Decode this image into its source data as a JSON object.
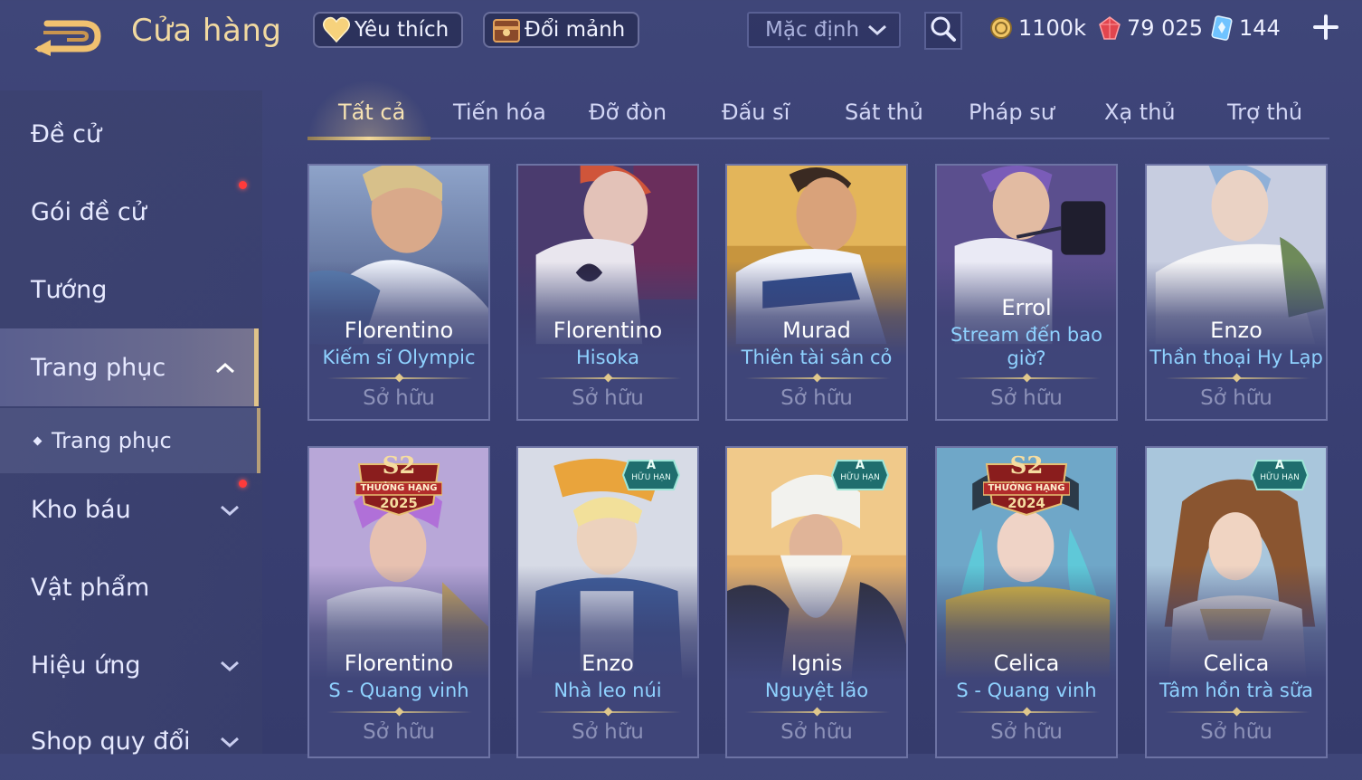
{
  "header": {
    "title": "Cửa hàng",
    "favorites_label": "Yêu thích",
    "exchange_label": "Đổi mảnh",
    "sort_label": "Mặc định",
    "currencies": [
      {
        "name": "gold",
        "value": "1100k"
      },
      {
        "name": "vouchers",
        "value": "79 025"
      },
      {
        "name": "diamonds",
        "value": "144"
      }
    ]
  },
  "sidebar": {
    "items": [
      {
        "label": "Đề cử"
      },
      {
        "label": "Gói đề cử"
      },
      {
        "label": "Tướng"
      },
      {
        "label": "Trang phục"
      },
      {
        "label": "Kho báu"
      },
      {
        "label": "Vật phẩm"
      },
      {
        "label": "Hiệu ứng"
      },
      {
        "label": "Shop quy đổi"
      }
    ],
    "sub_item": "Trang phục"
  },
  "tabs": [
    "Tất cả",
    "Tiến hóa",
    "Đỡ đòn",
    "Đấu sĩ",
    "Sát thủ",
    "Pháp sư",
    "Xạ thủ",
    "Trợ thủ"
  ],
  "cards": [
    {
      "hero": "Florentino",
      "skin": "Kiếm sĩ Olympic",
      "status": "Sở hữu"
    },
    {
      "hero": "Florentino",
      "skin": "Hisoka",
      "status": "Sở hữu"
    },
    {
      "hero": "Murad",
      "skin": "Thiên tài sân cỏ",
      "status": "Sở hữu"
    },
    {
      "hero": "Errol",
      "skin": "Stream đến bao giờ?",
      "status": "Sở hữu"
    },
    {
      "hero": "Enzo",
      "skin": "Thần thoại Hy Lạp",
      "status": "Sở hữu"
    },
    {
      "hero": "Florentino",
      "skin": "S - Quang vinh",
      "status": "Sở hữu",
      "badge": {
        "season": "S2",
        "line1": "THƯỞNG HẠNG",
        "year": "2025"
      }
    },
    {
      "hero": "Enzo",
      "skin": "Nhà leo núi",
      "status": "Sở hữu",
      "badge": {
        "tier": "A",
        "line1": "HỮU HẠN"
      }
    },
    {
      "hero": "Ignis",
      "skin": "Nguyệt lão",
      "status": "Sở hữu",
      "badge": {
        "tier": "A",
        "line1": "HỮU HẠN"
      }
    },
    {
      "hero": "Celica",
      "skin": "S - Quang vinh",
      "status": "Sở hữu",
      "badge": {
        "season": "S2",
        "line1": "THƯỞNG HẠNG",
        "year": "2024"
      }
    },
    {
      "hero": "Celica",
      "skin": "Tâm hồn trà sữa",
      "status": "Sở hữu",
      "badge": {
        "tier": "A",
        "line1": "HỮU HẠN"
      }
    }
  ],
  "colors": {
    "background": "#3c4276",
    "title_gold": "#f1d9a0",
    "skin_name": "#8fd2ff",
    "owned": "#8c91b8",
    "notification": "#ff3b3b"
  }
}
